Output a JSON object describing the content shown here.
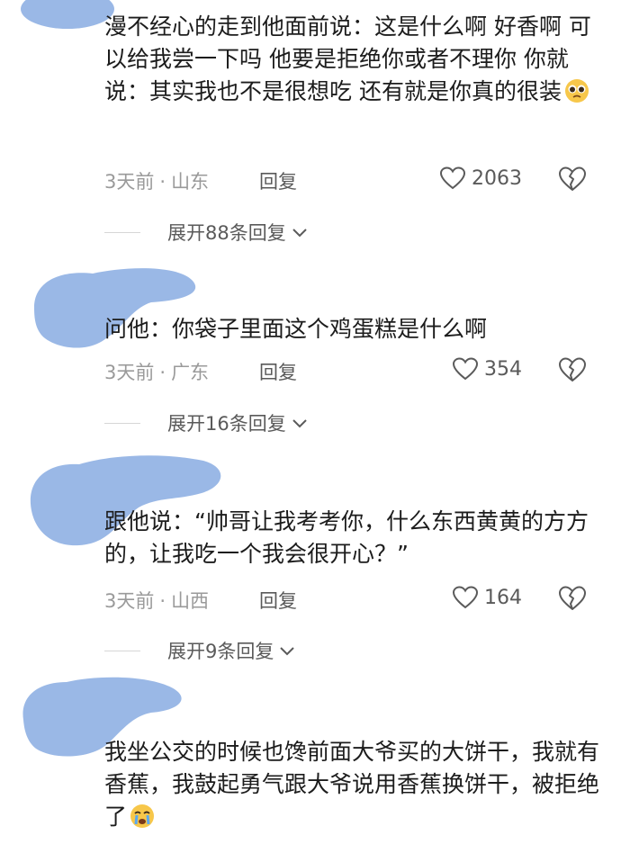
{
  "comments": [
    {
      "text": "漫不经心的走到他面前说：这是什么啊 好香啊 可以给我尝一下吗 他要是拒绝你或者不理你 你就说：其实我也不是很想吃 还有就是你真的很装",
      "emoji": "pleading-face",
      "time": "3天前",
      "location": "山东",
      "reply_label": "回复",
      "likes": "2063",
      "expand_label": "展开88条回复"
    },
    {
      "text": "问他：你袋子里面这个鸡蛋糕是什么啊",
      "time": "3天前",
      "location": "广东",
      "reply_label": "回复",
      "likes": "354",
      "expand_label": "展开16条回复"
    },
    {
      "text": "跟他说：“帅哥让我考考你，什么东西黄黄的方方的，让我吃一个我会很开心？”",
      "time": "3天前",
      "location": "山西",
      "reply_label": "回复",
      "likes": "164",
      "expand_label": "展开9条回复"
    },
    {
      "text": "我坐公交的时候也馋前面大爷买的大饼干，我就有香蕉，我鼓起勇气跟大爷说用香蕉换饼干，被拒绝了",
      "emoji": "crying-face"
    }
  ],
  "meta_separator": "·",
  "colors": {
    "text": "#1c1c1c",
    "meta_gray": "#9a9a9a",
    "action_gray": "#5a5a5a",
    "redaction_blue": "#9ab8e6"
  },
  "icons": {
    "like": "heart-outline-icon",
    "dislike": "broken-heart-icon",
    "expand": "chevron-down-icon"
  }
}
